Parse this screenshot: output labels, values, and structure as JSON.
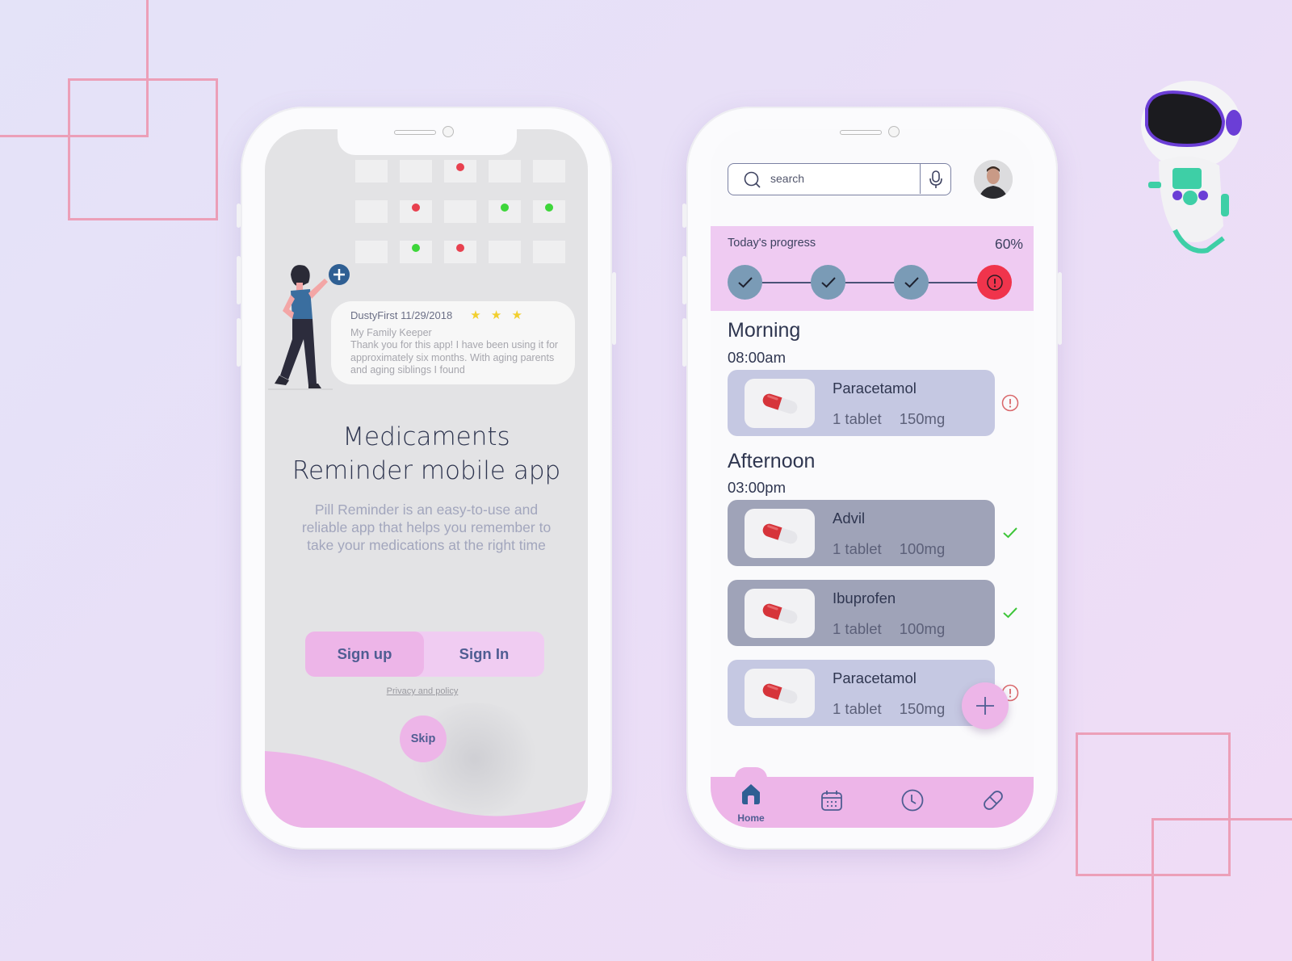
{
  "colors": {
    "background_start": "#e4e3f8",
    "background_end": "#f0dcf6",
    "accent_pink": "#edb5e8",
    "accent_light_pink": "#f0ccf2",
    "primary_text": "#2f3650",
    "button_text": "#4f5d92",
    "step_done": "#7a9bb6",
    "step_alert": "#f0344c",
    "dot_red": "#e8414f",
    "dot_green": "#3ed63a",
    "card_pending": "#c5c8e2",
    "card_done": "#9fa3b8",
    "check_green": "#3ec63a",
    "alert_red": "#d9666a",
    "deco_line": "#ec9fb8"
  },
  "onboarding": {
    "calendar": {
      "rows": [
        [
          "none",
          "none",
          "red",
          "none",
          "none"
        ],
        [
          "none",
          "red",
          "none",
          "green",
          "green"
        ],
        [
          "none",
          "green",
          "red",
          "none",
          "none"
        ]
      ]
    },
    "review": {
      "author": "DustyFirst 11/29/2018",
      "stars": "★ ★ ★",
      "rating": 3,
      "title": "My Family Keeper",
      "body": "Thank you for this app! I have been using it for approximately six months. With aging parents and aging siblings I found"
    },
    "title": "Medicaments Reminder mobile app",
    "description": "Pill Reminder is an easy-to-use and reliable app that helps you remember to take your medications at the right time",
    "signup_label": "Sign up",
    "signin_label": "Sign In",
    "privacy_label": "Privacy and policy",
    "skip_label": "Skip"
  },
  "home": {
    "search": {
      "placeholder": "search",
      "value": ""
    },
    "progress": {
      "label": "Today's progress",
      "value_text": "60%",
      "percent": 60,
      "steps": [
        "done",
        "done",
        "done",
        "alert"
      ]
    },
    "sections": [
      {
        "title": "Morning",
        "time": "08:00am",
        "meds": [
          {
            "name": "Paracetamol",
            "quantity": "1 tablet",
            "dosage": "150mg",
            "status": "missed"
          }
        ]
      },
      {
        "title": "Afternoon",
        "time": "03:00pm",
        "meds": [
          {
            "name": "Advil",
            "quantity": "1 tablet",
            "dosage": "100mg",
            "status": "taken"
          },
          {
            "name": "Ibuprofen",
            "quantity": "1 tablet",
            "dosage": "100mg",
            "status": "taken"
          },
          {
            "name": "Paracetamol",
            "quantity": "1 tablet",
            "dosage": "150mg",
            "status": "missed"
          }
        ]
      }
    ],
    "fab_icon": "plus-icon",
    "nav": [
      {
        "label": "Home",
        "icon": "home-icon",
        "active": true
      },
      {
        "label": "",
        "icon": "calendar-icon",
        "active": false
      },
      {
        "label": "",
        "icon": "clock-icon",
        "active": false
      },
      {
        "label": "",
        "icon": "pill-icon",
        "active": false
      }
    ]
  }
}
